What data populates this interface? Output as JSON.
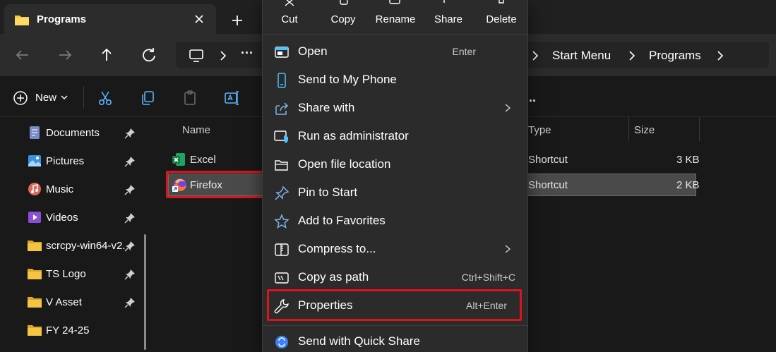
{
  "tab": {
    "title": "Programs"
  },
  "breadcrumb": [
    "Start Menu",
    "Programs"
  ],
  "command_bar": {
    "new_label": "New",
    "more_label": "..."
  },
  "sidebar": {
    "items": [
      {
        "label": "Documents",
        "icon": "documents-icon",
        "pinned": true
      },
      {
        "label": "Pictures",
        "icon": "pictures-icon",
        "pinned": true
      },
      {
        "label": "Music",
        "icon": "music-icon",
        "pinned": true
      },
      {
        "label": "Videos",
        "icon": "videos-icon",
        "pinned": true
      },
      {
        "label": "scrcpy-win64-v2.",
        "icon": "folder-icon",
        "pinned": true
      },
      {
        "label": "TS Logo",
        "icon": "folder-icon",
        "pinned": true
      },
      {
        "label": "V Asset",
        "icon": "folder-icon",
        "pinned": true
      },
      {
        "label": "FY 24-25",
        "icon": "folder-icon",
        "pinned": false
      }
    ]
  },
  "file_list": {
    "columns": {
      "name": "Name",
      "type": "Type",
      "size": "Size"
    },
    "rows": [
      {
        "name": "Excel",
        "type": "Shortcut",
        "size": "3 KB",
        "icon": "excel-icon",
        "selected": false
      },
      {
        "name": "Firefox",
        "type": "Shortcut",
        "size": "2 KB",
        "icon": "firefox-icon",
        "selected": true
      }
    ]
  },
  "context_menu": {
    "quick_actions": [
      {
        "label": "Cut",
        "icon": "cut-icon"
      },
      {
        "label": "Copy",
        "icon": "copy-icon"
      },
      {
        "label": "Rename",
        "icon": "rename-icon"
      },
      {
        "label": "Share",
        "icon": "share-icon"
      },
      {
        "label": "Delete",
        "icon": "delete-icon"
      }
    ],
    "items": [
      {
        "label": "Open",
        "shortcut": "Enter",
        "icon": "open-icon"
      },
      {
        "label": "Send to My Phone",
        "shortcut": "",
        "icon": "phone-icon"
      },
      {
        "label": "Share with",
        "shortcut": "",
        "icon": "share-with-icon",
        "submenu": true
      },
      {
        "label": "Run as administrator",
        "shortcut": "",
        "icon": "shield-icon"
      },
      {
        "label": "Open file location",
        "shortcut": "",
        "icon": "folder-open-icon"
      },
      {
        "label": "Pin to Start",
        "shortcut": "",
        "icon": "pin-icon"
      },
      {
        "label": "Add to Favorites",
        "shortcut": "",
        "icon": "star-icon"
      },
      {
        "label": "Compress to...",
        "shortcut": "",
        "icon": "zip-icon",
        "submenu": true
      },
      {
        "label": "Copy as path",
        "shortcut": "Ctrl+Shift+C",
        "icon": "copy-path-icon"
      },
      {
        "label": "Properties",
        "shortcut": "Alt+Enter",
        "icon": "wrench-icon",
        "highlighted": true
      },
      {
        "label": "Send with Quick Share",
        "shortcut": "",
        "icon": "quick-share-icon"
      }
    ]
  },
  "colors": {
    "highlight_outline": "#e0121b",
    "accent": "#4cc2ff",
    "folder": "#f5c542"
  }
}
